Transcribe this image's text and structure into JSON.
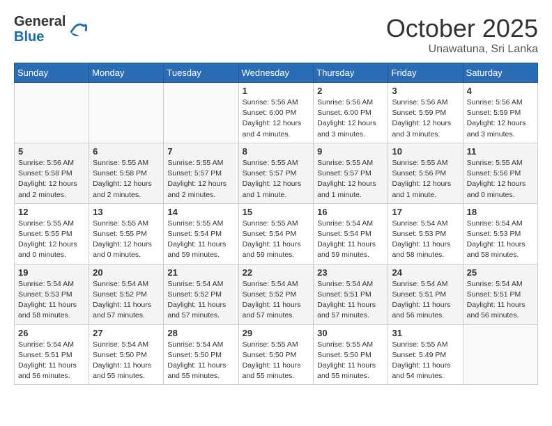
{
  "header": {
    "logo_general": "General",
    "logo_blue": "Blue",
    "month": "October 2025",
    "location": "Unawatuna, Sri Lanka"
  },
  "days_of_week": [
    "Sunday",
    "Monday",
    "Tuesday",
    "Wednesday",
    "Thursday",
    "Friday",
    "Saturday"
  ],
  "weeks": [
    [
      {
        "day": "",
        "sunrise": "",
        "sunset": "",
        "daylight": ""
      },
      {
        "day": "",
        "sunrise": "",
        "sunset": "",
        "daylight": ""
      },
      {
        "day": "",
        "sunrise": "",
        "sunset": "",
        "daylight": ""
      },
      {
        "day": "1",
        "sunrise": "Sunrise: 5:56 AM",
        "sunset": "Sunset: 6:00 PM",
        "daylight": "Daylight: 12 hours and 4 minutes."
      },
      {
        "day": "2",
        "sunrise": "Sunrise: 5:56 AM",
        "sunset": "Sunset: 6:00 PM",
        "daylight": "Daylight: 12 hours and 3 minutes."
      },
      {
        "day": "3",
        "sunrise": "Sunrise: 5:56 AM",
        "sunset": "Sunset: 5:59 PM",
        "daylight": "Daylight: 12 hours and 3 minutes."
      },
      {
        "day": "4",
        "sunrise": "Sunrise: 5:56 AM",
        "sunset": "Sunset: 5:59 PM",
        "daylight": "Daylight: 12 hours and 3 minutes."
      }
    ],
    [
      {
        "day": "5",
        "sunrise": "Sunrise: 5:56 AM",
        "sunset": "Sunset: 5:58 PM",
        "daylight": "Daylight: 12 hours and 2 minutes."
      },
      {
        "day": "6",
        "sunrise": "Sunrise: 5:55 AM",
        "sunset": "Sunset: 5:58 PM",
        "daylight": "Daylight: 12 hours and 2 minutes."
      },
      {
        "day": "7",
        "sunrise": "Sunrise: 5:55 AM",
        "sunset": "Sunset: 5:57 PM",
        "daylight": "Daylight: 12 hours and 2 minutes."
      },
      {
        "day": "8",
        "sunrise": "Sunrise: 5:55 AM",
        "sunset": "Sunset: 5:57 PM",
        "daylight": "Daylight: 12 hours and 1 minute."
      },
      {
        "day": "9",
        "sunrise": "Sunrise: 5:55 AM",
        "sunset": "Sunset: 5:57 PM",
        "daylight": "Daylight: 12 hours and 1 minute."
      },
      {
        "day": "10",
        "sunrise": "Sunrise: 5:55 AM",
        "sunset": "Sunset: 5:56 PM",
        "daylight": "Daylight: 12 hours and 1 minute."
      },
      {
        "day": "11",
        "sunrise": "Sunrise: 5:55 AM",
        "sunset": "Sunset: 5:56 PM",
        "daylight": "Daylight: 12 hours and 0 minutes."
      }
    ],
    [
      {
        "day": "12",
        "sunrise": "Sunrise: 5:55 AM",
        "sunset": "Sunset: 5:55 PM",
        "daylight": "Daylight: 12 hours and 0 minutes."
      },
      {
        "day": "13",
        "sunrise": "Sunrise: 5:55 AM",
        "sunset": "Sunset: 5:55 PM",
        "daylight": "Daylight: 12 hours and 0 minutes."
      },
      {
        "day": "14",
        "sunrise": "Sunrise: 5:55 AM",
        "sunset": "Sunset: 5:54 PM",
        "daylight": "Daylight: 11 hours and 59 minutes."
      },
      {
        "day": "15",
        "sunrise": "Sunrise: 5:55 AM",
        "sunset": "Sunset: 5:54 PM",
        "daylight": "Daylight: 11 hours and 59 minutes."
      },
      {
        "day": "16",
        "sunrise": "Sunrise: 5:54 AM",
        "sunset": "Sunset: 5:54 PM",
        "daylight": "Daylight: 11 hours and 59 minutes."
      },
      {
        "day": "17",
        "sunrise": "Sunrise: 5:54 AM",
        "sunset": "Sunset: 5:53 PM",
        "daylight": "Daylight: 11 hours and 58 minutes."
      },
      {
        "day": "18",
        "sunrise": "Sunrise: 5:54 AM",
        "sunset": "Sunset: 5:53 PM",
        "daylight": "Daylight: 11 hours and 58 minutes."
      }
    ],
    [
      {
        "day": "19",
        "sunrise": "Sunrise: 5:54 AM",
        "sunset": "Sunset: 5:53 PM",
        "daylight": "Daylight: 11 hours and 58 minutes."
      },
      {
        "day": "20",
        "sunrise": "Sunrise: 5:54 AM",
        "sunset": "Sunset: 5:52 PM",
        "daylight": "Daylight: 11 hours and 57 minutes."
      },
      {
        "day": "21",
        "sunrise": "Sunrise: 5:54 AM",
        "sunset": "Sunset: 5:52 PM",
        "daylight": "Daylight: 11 hours and 57 minutes."
      },
      {
        "day": "22",
        "sunrise": "Sunrise: 5:54 AM",
        "sunset": "Sunset: 5:52 PM",
        "daylight": "Daylight: 11 hours and 57 minutes."
      },
      {
        "day": "23",
        "sunrise": "Sunrise: 5:54 AM",
        "sunset": "Sunset: 5:51 PM",
        "daylight": "Daylight: 11 hours and 57 minutes."
      },
      {
        "day": "24",
        "sunrise": "Sunrise: 5:54 AM",
        "sunset": "Sunset: 5:51 PM",
        "daylight": "Daylight: 11 hours and 56 minutes."
      },
      {
        "day": "25",
        "sunrise": "Sunrise: 5:54 AM",
        "sunset": "Sunset: 5:51 PM",
        "daylight": "Daylight: 11 hours and 56 minutes."
      }
    ],
    [
      {
        "day": "26",
        "sunrise": "Sunrise: 5:54 AM",
        "sunset": "Sunset: 5:51 PM",
        "daylight": "Daylight: 11 hours and 56 minutes."
      },
      {
        "day": "27",
        "sunrise": "Sunrise: 5:54 AM",
        "sunset": "Sunset: 5:50 PM",
        "daylight": "Daylight: 11 hours and 55 minutes."
      },
      {
        "day": "28",
        "sunrise": "Sunrise: 5:54 AM",
        "sunset": "Sunset: 5:50 PM",
        "daylight": "Daylight: 11 hours and 55 minutes."
      },
      {
        "day": "29",
        "sunrise": "Sunrise: 5:55 AM",
        "sunset": "Sunset: 5:50 PM",
        "daylight": "Daylight: 11 hours and 55 minutes."
      },
      {
        "day": "30",
        "sunrise": "Sunrise: 5:55 AM",
        "sunset": "Sunset: 5:50 PM",
        "daylight": "Daylight: 11 hours and 55 minutes."
      },
      {
        "day": "31",
        "sunrise": "Sunrise: 5:55 AM",
        "sunset": "Sunset: 5:49 PM",
        "daylight": "Daylight: 11 hours and 54 minutes."
      },
      {
        "day": "",
        "sunrise": "",
        "sunset": "",
        "daylight": ""
      }
    ]
  ]
}
